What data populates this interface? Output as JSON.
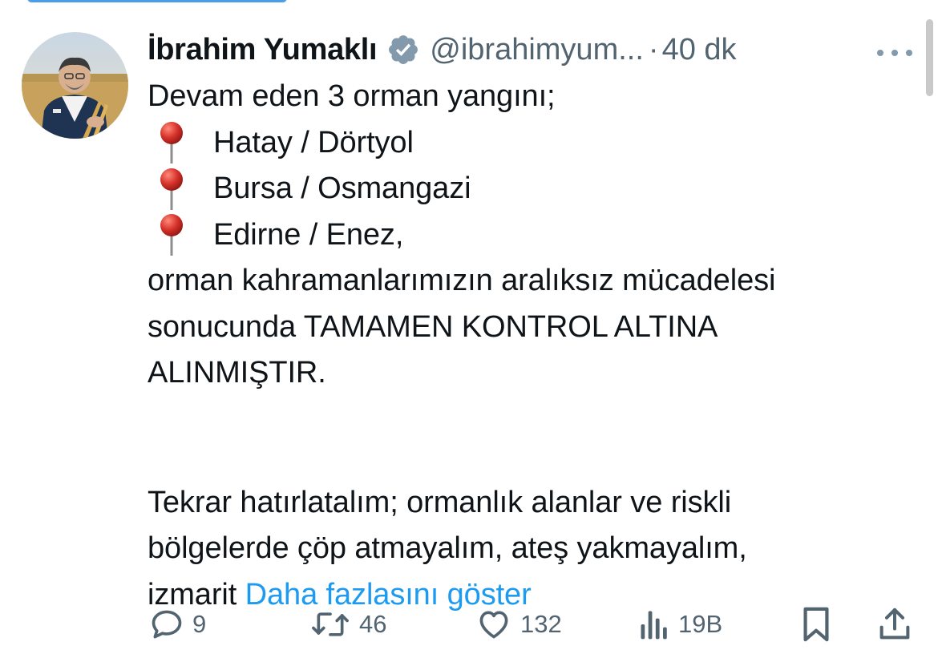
{
  "tweet": {
    "author": {
      "display_name": "İbrahim Yumaklı",
      "handle": "@ibrahimyum...",
      "verified": true
    },
    "separator": "·",
    "time_ago": "40 dk",
    "lines": {
      "intro": "Devam eden 3 orman yangını;",
      "loc1": "Hatay / Dörtyol",
      "loc2": "Bursa / Osmangazi",
      "loc3": "Edirne / Enez,",
      "p1": "orman kahramanlarımızın aralıksız mücadelesi",
      "p2": "sonucunda TAMAMEN KONTROL ALTINA",
      "p3": "ALINMIŞTIR.",
      "p4": "Tekrar hatırlatalım; ormanlık alanlar ve riskli",
      "p5": "bölgelerde çöp atmayalım, ateş yakmayalım,",
      "p6": "izmarit"
    },
    "show_more": "Daha fazlasını göster",
    "stats": {
      "replies": "9",
      "retweets": "46",
      "likes": "132",
      "views": "19B"
    }
  },
  "colors": {
    "text": "#0f1419",
    "muted": "#536471",
    "link": "#1d9bf0",
    "verified_badge": "#829aab"
  },
  "icons": [
    "verified-badge-icon",
    "more-icon",
    "pin-icon",
    "reply-icon",
    "retweet-icon",
    "like-icon",
    "views-icon",
    "bookmark-icon",
    "share-icon"
  ]
}
